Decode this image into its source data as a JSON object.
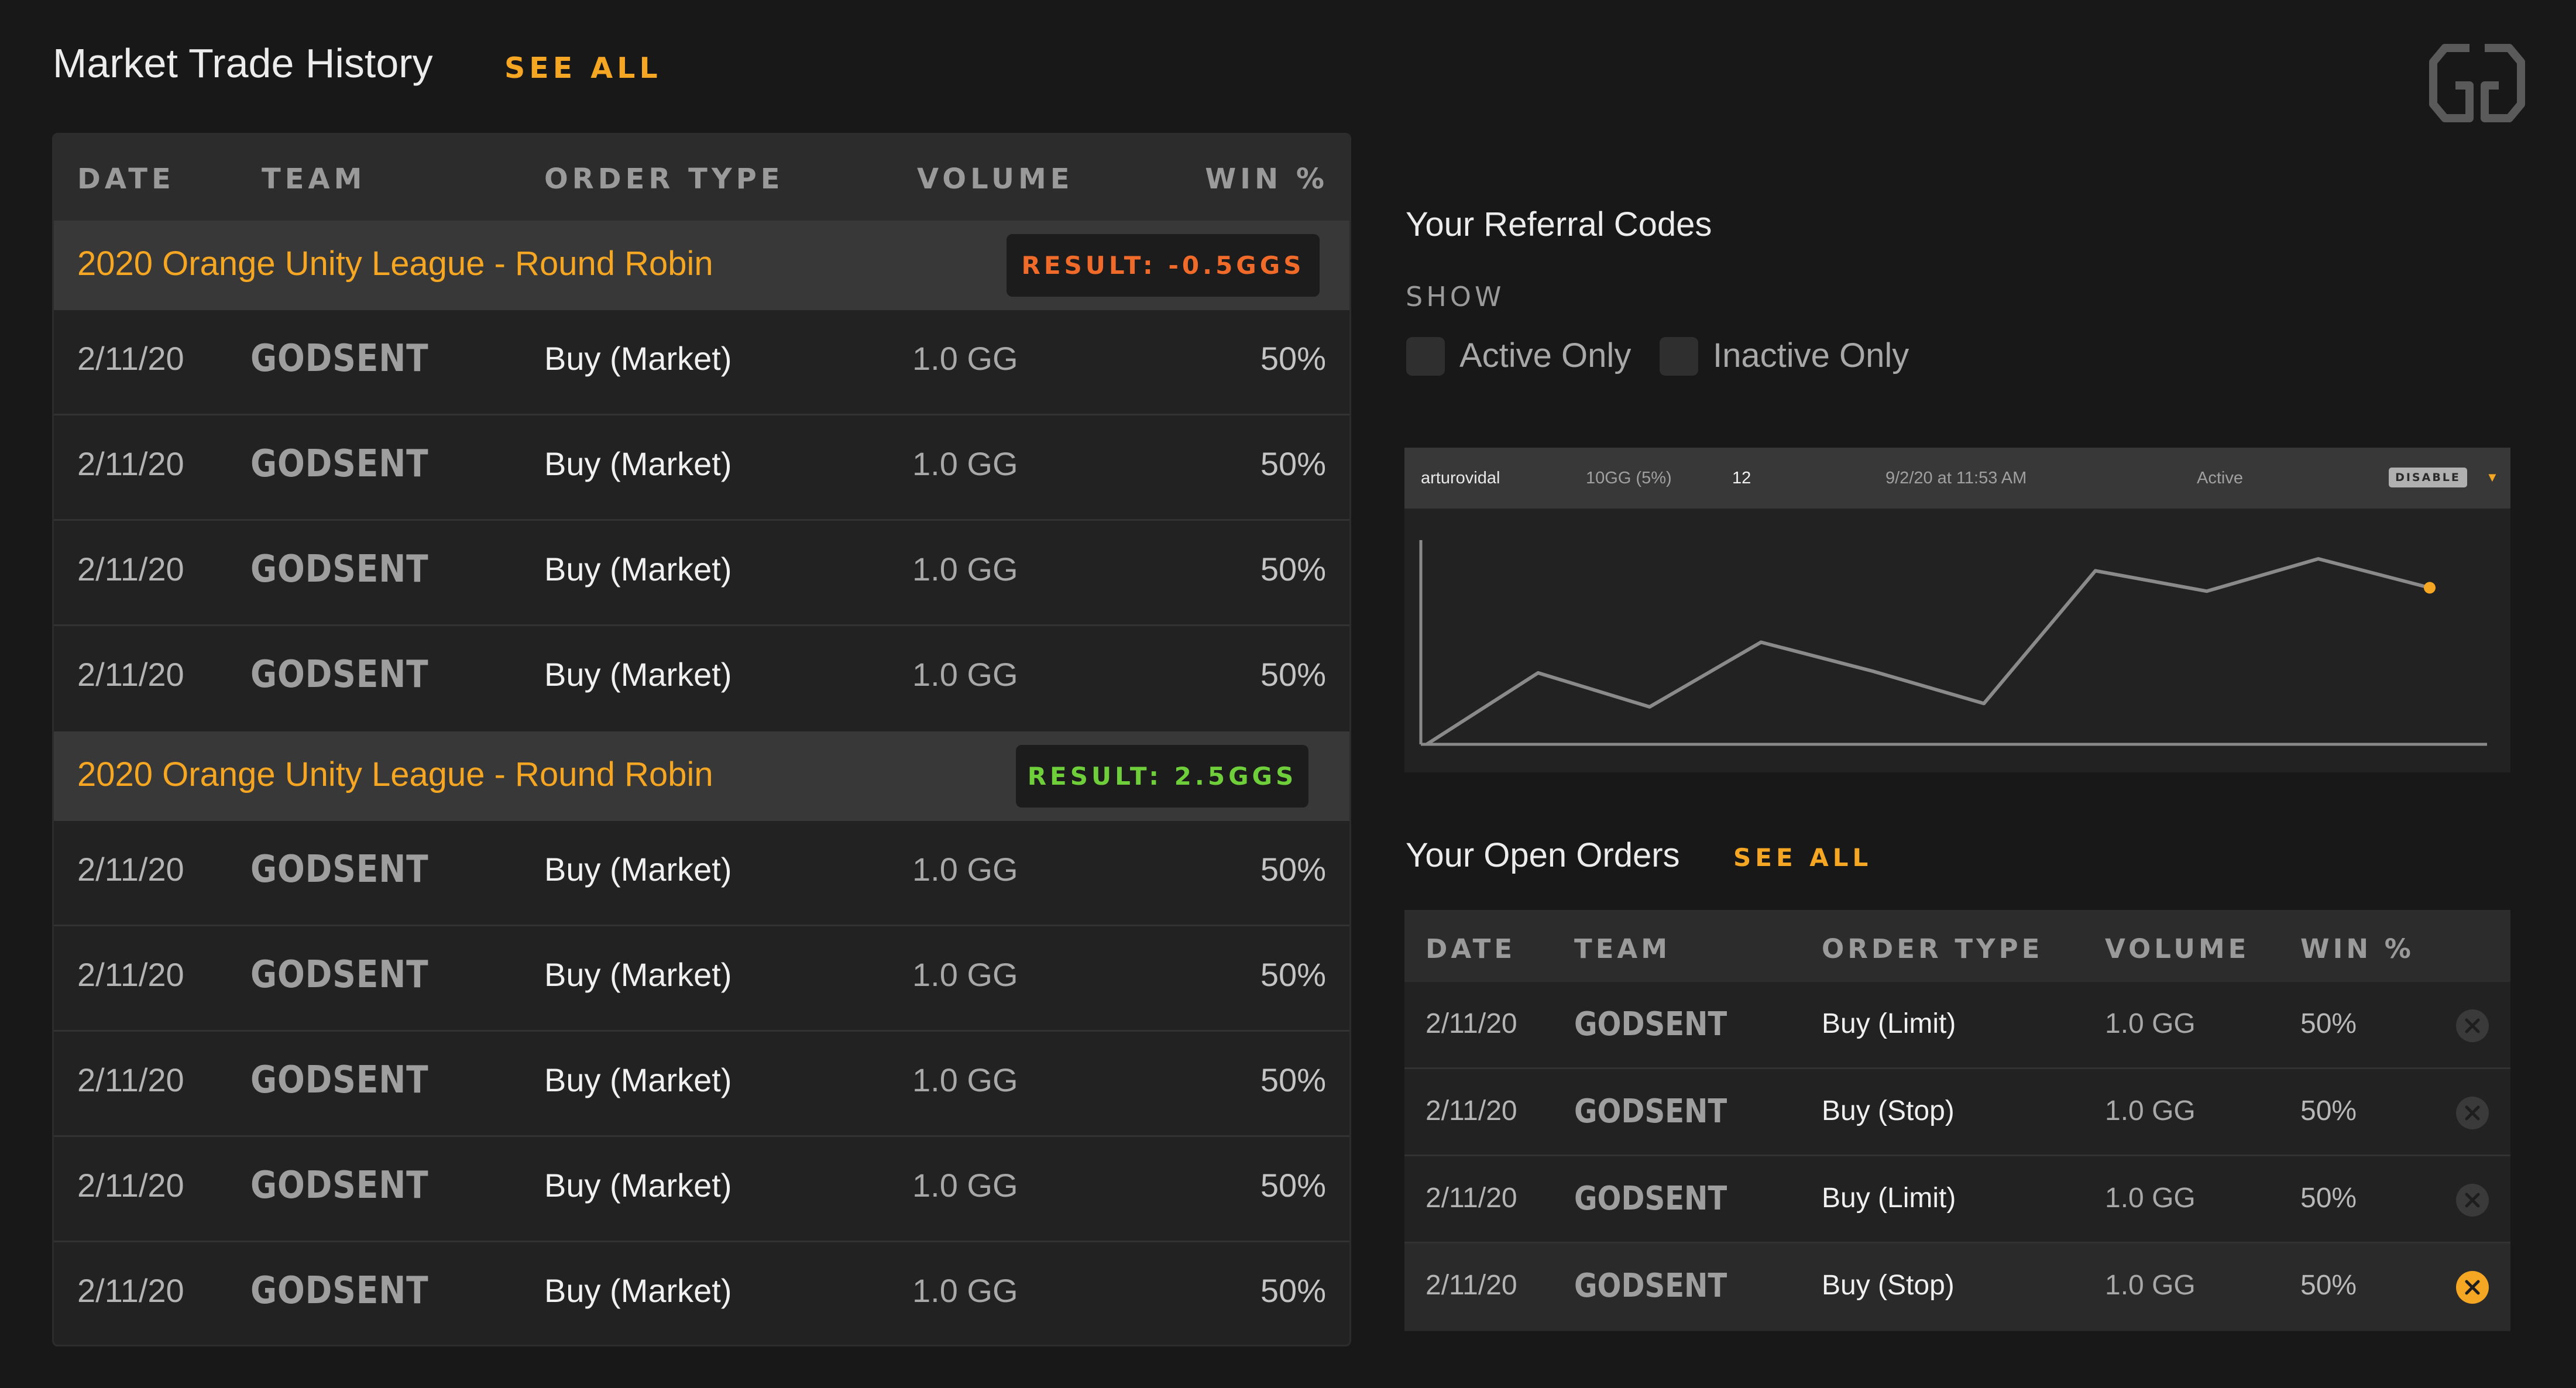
{
  "trade_history": {
    "title": "Market Trade History",
    "see_all": "SEE ALL",
    "columns": [
      "DATE",
      "TEAM",
      "ORDER TYPE",
      "VOLUME",
      "WIN %"
    ],
    "groups": [
      {
        "title": "2020 Orange Unity League - Round Robin",
        "result": "RESULT: -0.5GGS",
        "result_color": "#f06a2a",
        "rows": [
          {
            "date": "2/11/20",
            "team": "GODSENT",
            "order_type": "Buy (Market)",
            "volume": "1.0 GG",
            "win": "50%"
          },
          {
            "date": "2/11/20",
            "team": "GODSENT",
            "order_type": "Buy (Market)",
            "volume": "1.0 GG",
            "win": "50%"
          },
          {
            "date": "2/11/20",
            "team": "GODSENT",
            "order_type": "Buy (Market)",
            "volume": "1.0 GG",
            "win": "50%"
          },
          {
            "date": "2/11/20",
            "team": "GODSENT",
            "order_type": "Buy (Market)",
            "volume": "1.0 GG",
            "win": "50%"
          }
        ]
      },
      {
        "title": "2020 Orange Unity League - Round Robin",
        "result": "RESULT: 2.5GGS",
        "result_color": "#6fcf3a",
        "rows": [
          {
            "date": "2/11/20",
            "team": "GODSENT",
            "order_type": "Buy (Market)",
            "volume": "1.0 GG",
            "win": "50%"
          },
          {
            "date": "2/11/20",
            "team": "GODSENT",
            "order_type": "Buy (Market)",
            "volume": "1.0 GG",
            "win": "50%"
          },
          {
            "date": "2/11/20",
            "team": "GODSENT",
            "order_type": "Buy (Market)",
            "volume": "1.0 GG",
            "win": "50%"
          },
          {
            "date": "2/11/20",
            "team": "GODSENT",
            "order_type": "Buy (Market)",
            "volume": "1.0 GG",
            "win": "50%"
          },
          {
            "date": "2/11/20",
            "team": "GODSENT",
            "order_type": "Buy (Market)",
            "volume": "1.0 GG",
            "win": "50%"
          }
        ]
      }
    ]
  },
  "referral": {
    "title": "Your Referral Codes",
    "show_label": "SHOW",
    "filters": [
      "Active Only",
      "Inactive Only"
    ],
    "code": {
      "user": "arturovidal",
      "amount": "10GG (5%)",
      "count": "12",
      "date": "9/2/20 at 11:53 AM",
      "status": "Active",
      "disable_label": "DISABLE",
      "caret_icon": "caret-down-icon"
    }
  },
  "chart_data": {
    "type": "line",
    "title": "",
    "xlabel": "",
    "ylabel": "",
    "grid": false,
    "x": [
      0,
      1,
      2,
      3,
      4,
      5,
      6,
      7,
      8,
      9
    ],
    "series": [
      {
        "values": [
          0,
          42,
          22,
          60,
          43,
          24,
          102,
          90,
          109,
          92
        ],
        "color": "#8a8a8a",
        "end_marker_color": "#f5a623"
      }
    ],
    "ylim": [
      0,
      120
    ]
  },
  "open_orders": {
    "title": "Your Open Orders",
    "see_all": "SEE ALL",
    "columns": [
      "DATE",
      "TEAM",
      "ORDER TYPE",
      "VOLUME",
      "WIN %"
    ],
    "rows": [
      {
        "date": "2/11/20",
        "team": "GODSENT",
        "order_type": "Buy (Limit)",
        "volume": "1.0 GG",
        "win": "50%",
        "active": false
      },
      {
        "date": "2/11/20",
        "team": "GODSENT",
        "order_type": "Buy (Stop)",
        "volume": "1.0 GG",
        "win": "50%",
        "active": false
      },
      {
        "date": "2/11/20",
        "team": "GODSENT",
        "order_type": "Buy (Limit)",
        "volume": "1.0 GG",
        "win": "50%",
        "active": false
      },
      {
        "date": "2/11/20",
        "team": "GODSENT",
        "order_type": "Buy (Stop)",
        "volume": "1.0 GG",
        "win": "50%",
        "active": true
      }
    ],
    "cancel_icon": "close-circle-icon"
  },
  "colors": {
    "accent": "#f5a623",
    "background": "#181818",
    "panel": "#222222",
    "loss": "#f06a2a",
    "gain": "#6fcf3a"
  }
}
